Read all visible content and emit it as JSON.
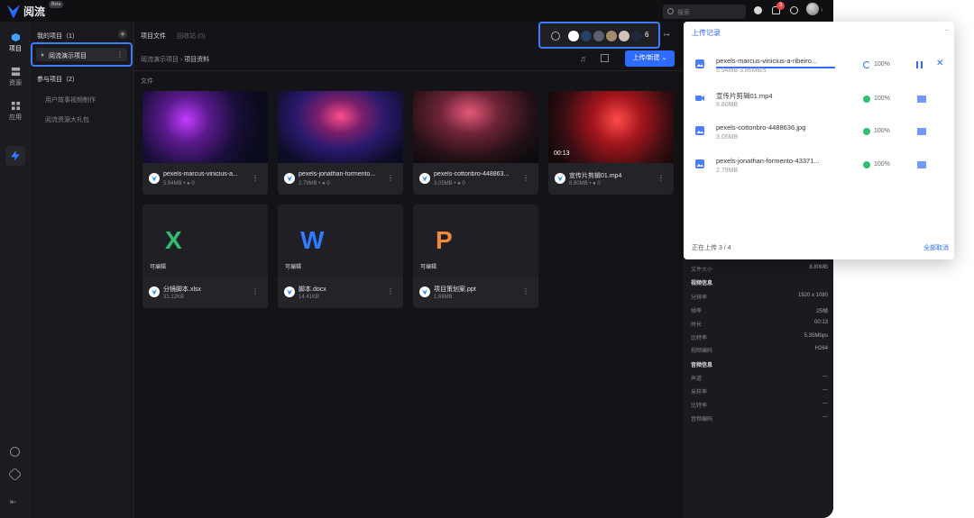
{
  "brand": {
    "name": "阅流",
    "badge": "Beta"
  },
  "topbar": {
    "search_placeholder": "搜索",
    "notification_count": "3"
  },
  "rail": {
    "items": [
      {
        "label": "项目"
      },
      {
        "label": "资源"
      },
      {
        "label": "应用"
      }
    ]
  },
  "sidebar": {
    "my_projects": "我的项目（1）",
    "active_project": "阅流演示项目",
    "joined_projects": "参与项目（2）",
    "joined": [
      "用户故事视频制作",
      "阅流资源大礼包"
    ]
  },
  "main": {
    "tabs": [
      "项目文件",
      "回收站 (0)"
    ],
    "breadcrumb": {
      "parent": "阅流演示项目",
      "current": "项目资料"
    },
    "collab_count": "6",
    "upload_button": "上传/新建 ⌄",
    "section_label": "文件",
    "files": [
      {
        "name": "pexels-marcus-vinicius-a...",
        "size": "5.94MB",
        "comments": "0",
        "kind": "image"
      },
      {
        "name": "pexels-jonathan-formento...",
        "size": "2.79MB",
        "comments": "0",
        "kind": "image"
      },
      {
        "name": "pexels-cottonbro-448863...",
        "size": "3.05MB",
        "comments": "0",
        "kind": "image"
      },
      {
        "name": "宣传片剪辑01.mp4",
        "size": "8.80MB",
        "comments": "0",
        "kind": "video",
        "duration": "00:13"
      },
      {
        "name": "分镜脚本.xlsx",
        "size": "31.12KB",
        "kind": "doc",
        "letter": "X",
        "color": "#2fbf71",
        "badge": "可编辑"
      },
      {
        "name": "脚本.docx",
        "size": "14.41KB",
        "kind": "doc",
        "letter": "W",
        "color": "#2f7bff",
        "badge": "可编辑"
      },
      {
        "name": "项目策划案.ppt",
        "size": "1.68MB",
        "kind": "doc",
        "letter": "P",
        "color": "#f08a3c",
        "badge": "可编辑"
      }
    ]
  },
  "details": {
    "file_size_label": "文件大小",
    "file_size": "8.80MB",
    "video_title": "视频信息",
    "video": [
      {
        "k": "分辨率",
        "v": "1920 x 1080"
      },
      {
        "k": "帧率",
        "v": "25帧"
      },
      {
        "k": "时长",
        "v": "00:13"
      },
      {
        "k": "比特率",
        "v": "5.35Mbps"
      },
      {
        "k": "视频编码",
        "v": "H264"
      }
    ],
    "audio_title": "音频信息",
    "audio": [
      {
        "k": "声道",
        "v": "---"
      },
      {
        "k": "采样率",
        "v": "---"
      },
      {
        "k": "比特率",
        "v": "---"
      },
      {
        "k": "音频编码",
        "v": "---"
      }
    ]
  },
  "upload_popup": {
    "title": "上传记录",
    "items": [
      {
        "name": "pexels-marcus-vinicius-a-ribeiro...",
        "size": "5.94MB",
        "speed": "3.86MB/s",
        "pct": "100%",
        "state": "uploading",
        "progress": 1.0
      },
      {
        "name": "宣传片剪辑01.mp4",
        "size": "8.80MB",
        "pct": "100%",
        "state": "done"
      },
      {
        "name": "pexels-cottonbro-4488636.jpg",
        "size": "3.05MB",
        "pct": "100%",
        "state": "done"
      },
      {
        "name": "pexels-jonathan-formento-43371...",
        "size": "2.79MB",
        "pct": "100%",
        "state": "done"
      }
    ],
    "footer": "正在上传 3 / 4",
    "cancel_all": "全部取消"
  },
  "colors": {
    "accent": "#2f6bff",
    "success": "#2fbf71",
    "panel_dark": "#141418"
  }
}
